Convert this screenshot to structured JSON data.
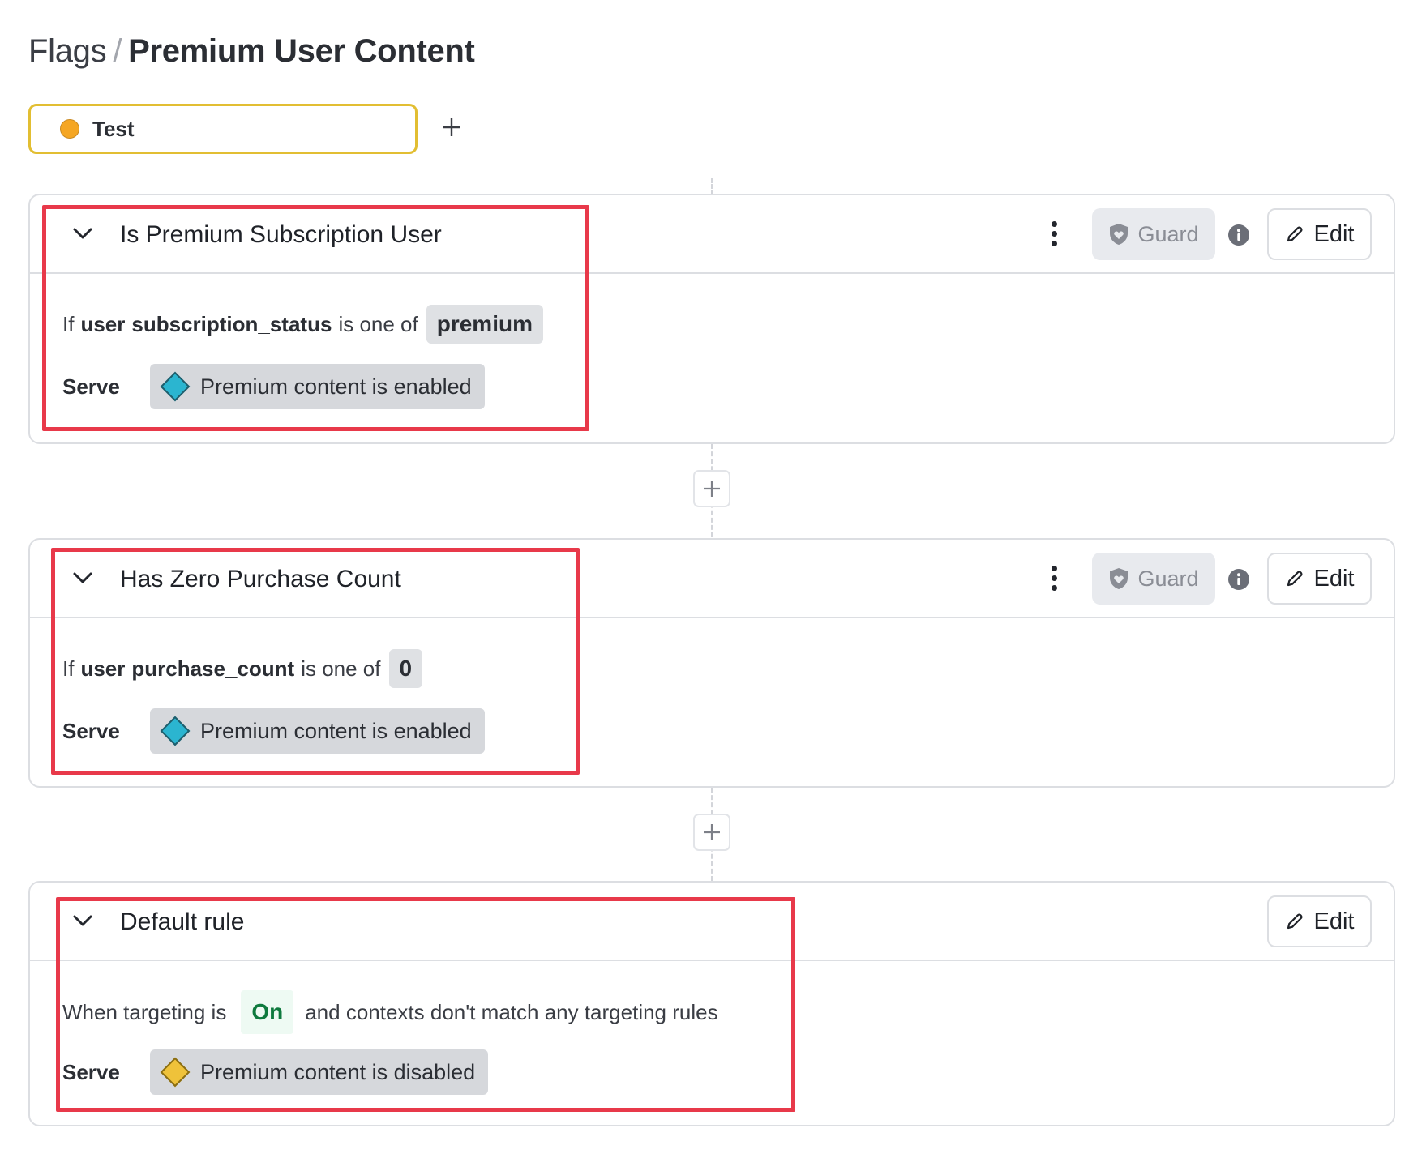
{
  "breadcrumb": {
    "parent": "Flags",
    "separator": "/",
    "current": "Premium User Content"
  },
  "environment": {
    "label": "Test",
    "dot_color": "#f5a623",
    "border_color": "#e2be32"
  },
  "rules": [
    {
      "title": "Is Premium Subscription User",
      "clause": {
        "prefix": "If",
        "context_kind": "user",
        "attribute": "subscription_status",
        "operator": "is one of",
        "values": [
          "premium"
        ]
      },
      "serve_label": "Serve",
      "variation": {
        "label": "Premium content is enabled",
        "color": "#2bb5d0"
      },
      "guard_label": "Guard",
      "edit_label": "Edit"
    },
    {
      "title": "Has Zero Purchase Count",
      "clause": {
        "prefix": "If",
        "context_kind": "user",
        "attribute": "purchase_count",
        "operator": "is one of",
        "values": [
          "0"
        ]
      },
      "serve_label": "Serve",
      "variation": {
        "label": "Premium content is enabled",
        "color": "#2bb5d0"
      },
      "guard_label": "Guard",
      "edit_label": "Edit"
    }
  ],
  "default_rule": {
    "title": "Default rule",
    "text_before": "When targeting is",
    "targeting_state": "On",
    "text_after": "and contexts don't match any targeting rules",
    "serve_label": "Serve",
    "variation": {
      "label": "Premium content is disabled",
      "color": "#efc23a"
    },
    "edit_label": "Edit"
  },
  "icons": {
    "chevron": "chevron-down-icon",
    "kebab": "more-vertical-icon",
    "guard": "shield-heart-icon",
    "info": "info-icon",
    "edit": "pencil-icon",
    "add": "plus-icon"
  },
  "highlight_color": "#e8394a"
}
